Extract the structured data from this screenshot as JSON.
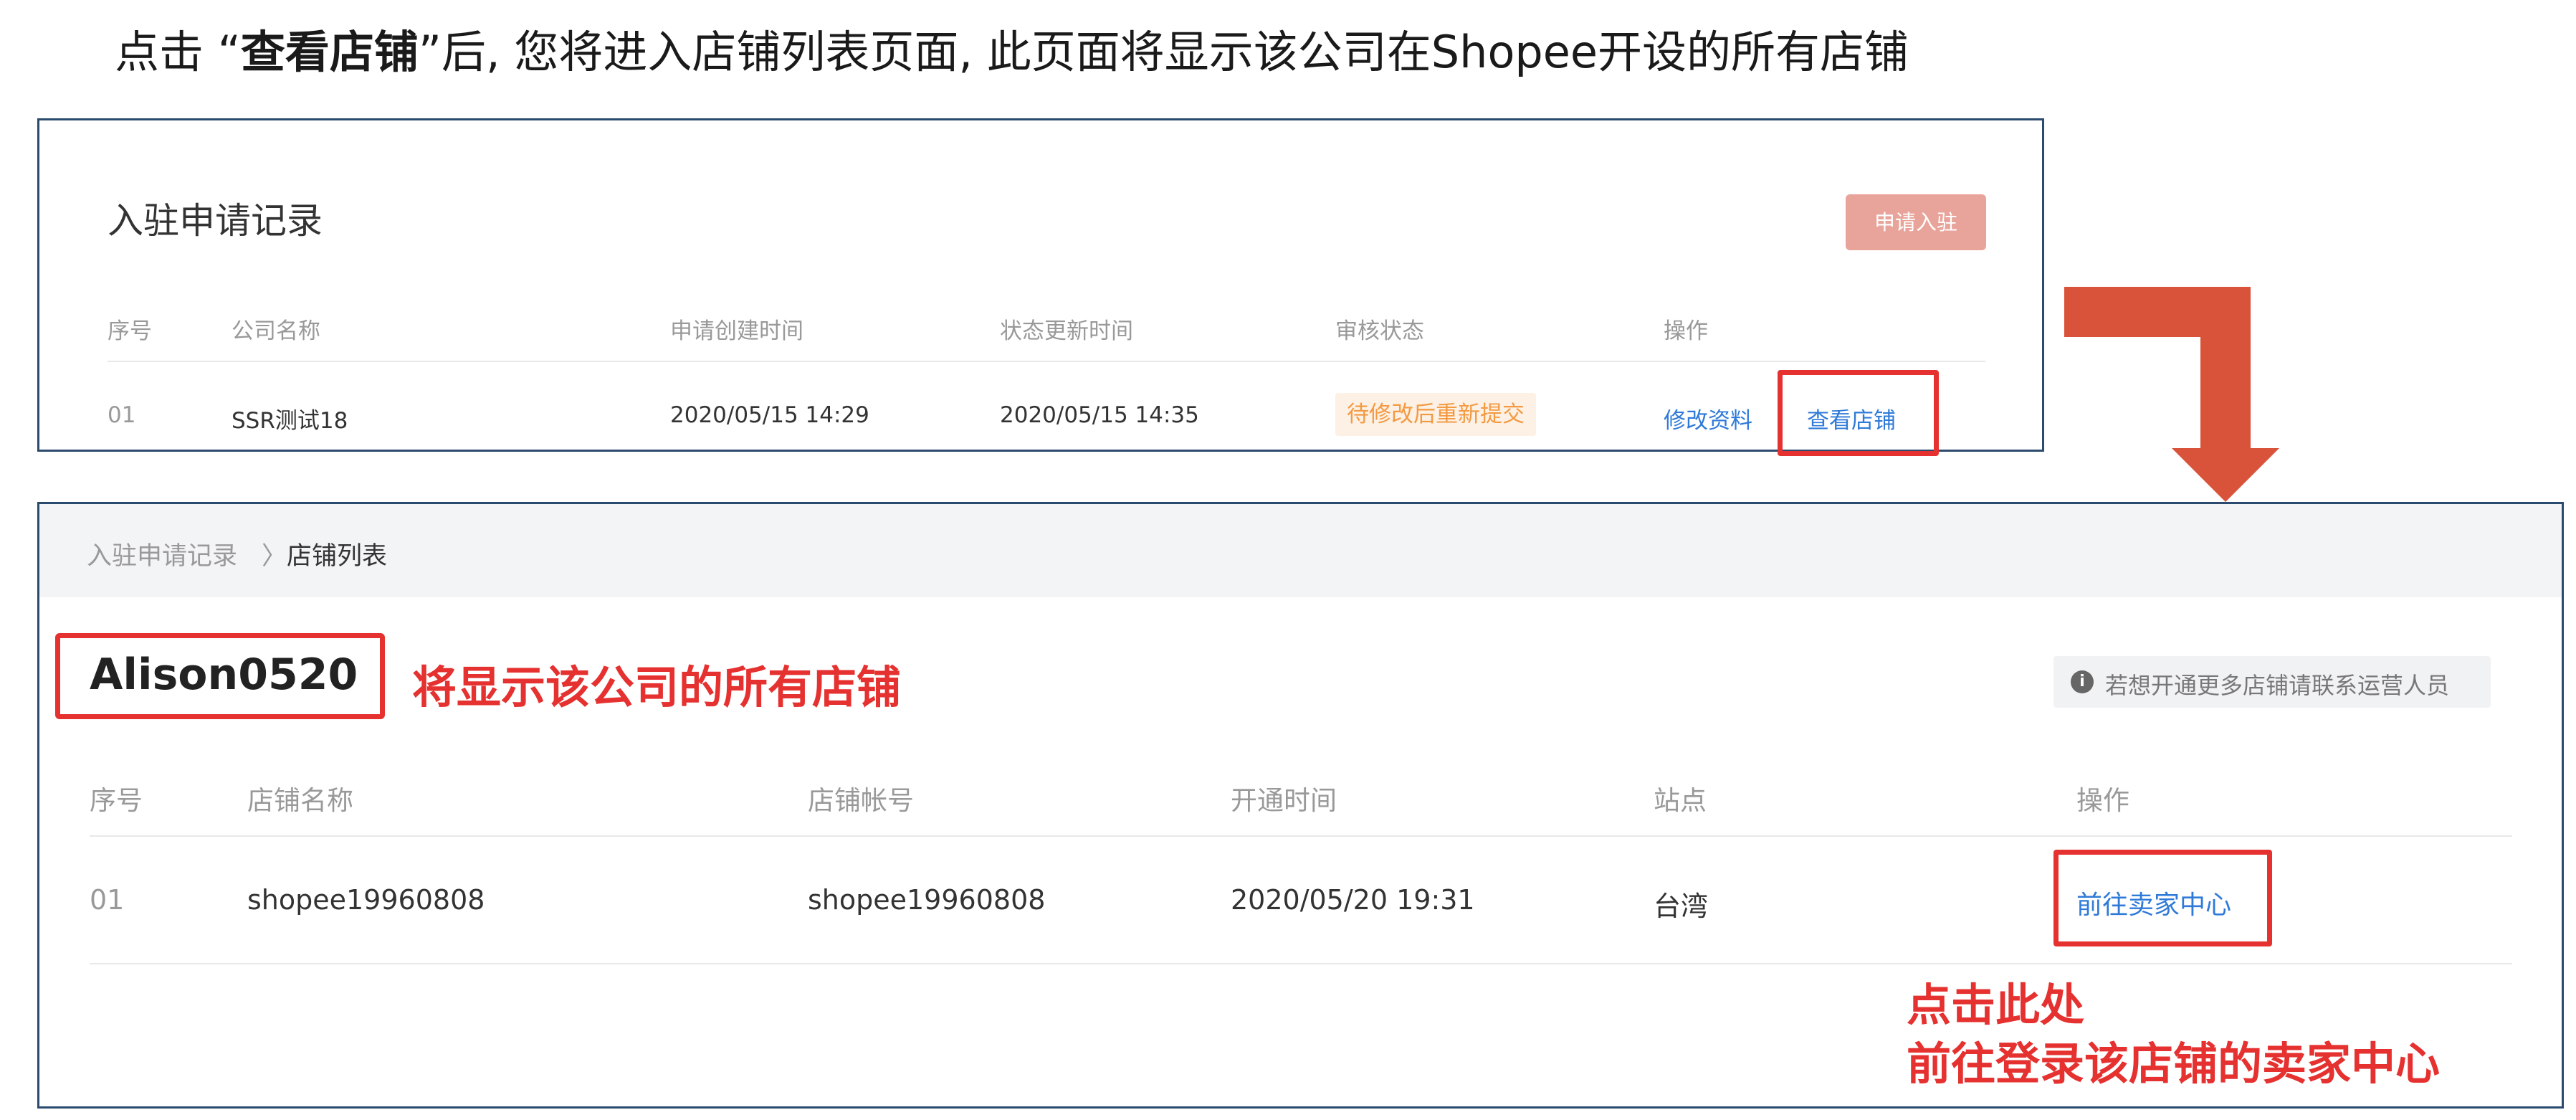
{
  "instruction": {
    "prefix": "点击 “",
    "emphasis": "查看店铺",
    "suffix": "”后, 您将进入店铺列表页面, 此页面将显示该公司在Shopee开设的所有店铺"
  },
  "records_panel": {
    "title": "入驻申请记录",
    "apply_button": "申请入驻",
    "columns": [
      "序号",
      "公司名称",
      "申请创建时间",
      "状态更新时间",
      "审核状态",
      "操作"
    ],
    "row": {
      "index": "01",
      "company": "SSR测试18",
      "created": "2020/05/15 14:29",
      "updated": "2020/05/15 14:35",
      "status": "待修改后重新提交",
      "action_edit": "修改资料",
      "action_view": "查看店铺"
    }
  },
  "shop_list_panel": {
    "breadcrumb": {
      "parent": "入驻申请记录",
      "separator": "〉",
      "current": "店铺列表"
    },
    "company_name": "Alison0520",
    "notice": {
      "icon": "info-icon",
      "text": "若想开通更多店铺请联系运营人员"
    },
    "columns": [
      "序号",
      "店铺名称",
      "店铺帐号",
      "开通时间",
      "站点",
      "操作"
    ],
    "row": {
      "index": "01",
      "shop_name": "shopee19960808",
      "shop_account": "shopee19960808",
      "opened": "2020/05/20 19:31",
      "site": "台湾",
      "action": "前往卖家中心"
    }
  },
  "annotations": {
    "company_note": "将显示该公司的所有店铺",
    "click_line1": "点击此处",
    "click_line2": "前往登录该店铺的卖家中心",
    "highlight_color": "#e5312f",
    "arrow_color": "#d9533a"
  }
}
